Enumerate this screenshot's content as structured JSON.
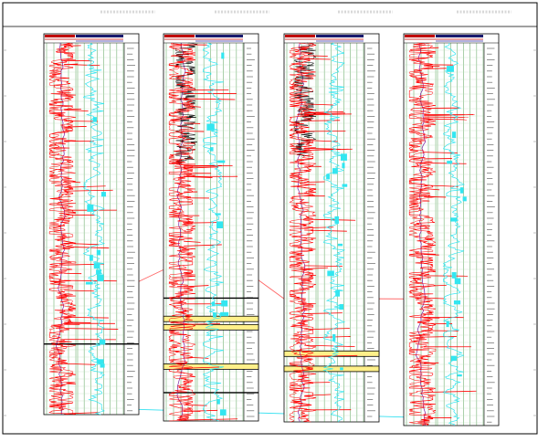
{
  "section": {
    "headers": [
      "",
      "",
      "",
      ""
    ],
    "wells": [
      {
        "id": "well-1",
        "markers": [
          {
            "depth_frac": 0.81,
            "highlight": false
          }
        ]
      },
      {
        "id": "well-2",
        "markers": [
          {
            "depth_frac": 0.675,
            "highlight": false
          },
          {
            "depth_frac": 0.73,
            "highlight": true
          },
          {
            "depth_frac": 0.752,
            "highlight": true
          },
          {
            "depth_frac": 0.856,
            "highlight": true
          },
          {
            "depth_frac": 0.925,
            "highlight": false
          }
        ]
      },
      {
        "id": "well-3",
        "markers": [
          {
            "depth_frac": 0.82,
            "highlight": true
          },
          {
            "depth_frac": 0.86,
            "highlight": true
          }
        ]
      },
      {
        "id": "well-4",
        "markers": []
      }
    ],
    "correlations": [
      {
        "color": "#ff6666",
        "from_well": 0,
        "to_well": 1,
        "from_frac": 0.66,
        "to_frac": 0.6
      },
      {
        "color": "#ff6666",
        "from_well": 1,
        "to_well": 2,
        "from_frac": 0.6,
        "to_frac": 0.675
      },
      {
        "color": "#ff6666",
        "from_well": 2,
        "to_well": 3,
        "from_frac": 0.675,
        "to_frac": 0.67
      },
      {
        "color": "#33e0f0",
        "from_well": 0,
        "to_well": 3,
        "from_frac": 0.985,
        "to_frac": 0.985
      }
    ],
    "colors": {
      "gamma_ray": "#ff0000",
      "resistivity": "#33e6f0",
      "caliper": "#7a1fa2",
      "dense_log": "#000000",
      "grid": "#2c8a2c",
      "correlation": "#ff6666",
      "marker_fill": "#fff08a"
    },
    "icons": [
      "well-log-track"
    ]
  }
}
